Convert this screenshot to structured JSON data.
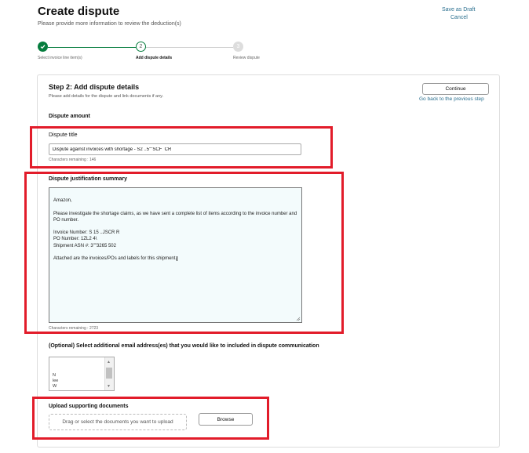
{
  "header": {
    "title": "Create dispute",
    "subtitle": "Please provide more information to review the deduction(s)",
    "save_draft": "Save as Draft",
    "cancel": "Cancel"
  },
  "stepper": {
    "steps": [
      {
        "number": "1",
        "label": "Select invoice line item(s)",
        "state": "complete"
      },
      {
        "number": "2",
        "label": "Add dispute details",
        "state": "current"
      },
      {
        "number": "3",
        "label": "Review dispute",
        "state": "upcoming"
      }
    ]
  },
  "step": {
    "heading": "Step 2: Add dispute details",
    "description": "Please add details for the dispute and link documents if any.",
    "continue_label": "Continue",
    "back_label": "Go back to the previous step"
  },
  "dispute_amount": {
    "heading": "Dispute amount"
  },
  "dispute_title": {
    "label": "Dispute title",
    "value": "Dispute against invoices with shortage - S2 ..5\"\"SCF  CR",
    "chars_remaining": "Characters remaining : 146"
  },
  "justification": {
    "label": "Dispute justification summary",
    "value": "Amazon,\n\nPlease investigate the shortage claims, as we have sent a complete list of items according to the invoice number and PO number.\n\nInvoice Number: S    15 ..JSCR    R\nPO Number: 1ZL2    4\\\nShipment ASN #: 3\"\"3265    502\n\nAttached are the invoices/POs and labels for this shipment.",
    "chars_remaining": "Characters remaining : 2723"
  },
  "email": {
    "label": "(Optional) Select additional email address(es) that you would like to included in dispute communication",
    "items": [
      "N",
      "lee",
      "W"
    ]
  },
  "upload": {
    "label": "Upload supporting documents",
    "dropzone_text": "Drag or select the documents you want to upload",
    "browse_label": "Browse"
  },
  "colors": {
    "accent_green": "#067d3e",
    "link_blue": "#2a6f8f",
    "highlight_red": "#e21c2a",
    "textarea_bg": "#f3fbfc"
  },
  "icons": {
    "step_complete": "check-icon",
    "resize": "resize-grip-icon"
  }
}
